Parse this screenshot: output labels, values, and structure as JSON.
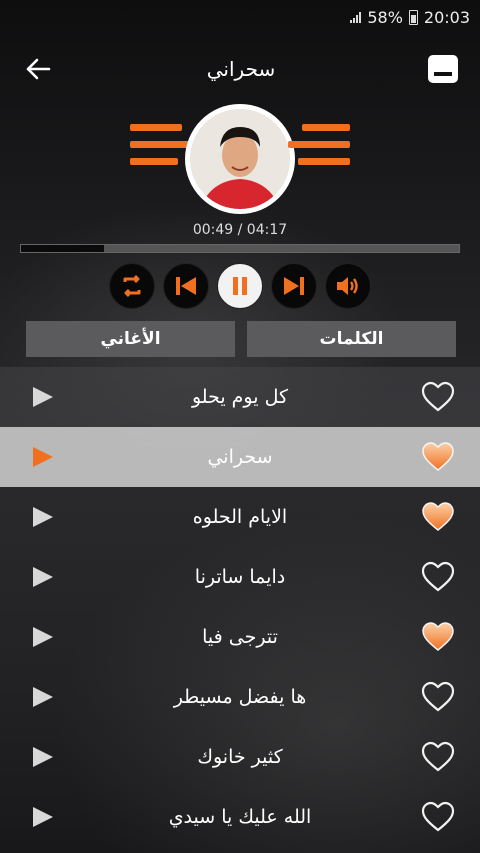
{
  "status_bar": {
    "battery_percent": "58%",
    "time": "20:03"
  },
  "header": {
    "title": "سحراني",
    "back_icon": "arrow-left-icon",
    "minimize_icon": "minimize-icon"
  },
  "player": {
    "time_display": "00:49 / 04:17",
    "progress": 0.19,
    "controls": [
      "repeat-icon",
      "skip-previous-icon",
      "pause-icon",
      "skip-next-icon",
      "volume-icon"
    ]
  },
  "tabs": {
    "songs": "الأغاني",
    "lyrics": "الكلمات"
  },
  "songs": [
    {
      "title": "كل يوم يحلو",
      "favorite": false,
      "active": false
    },
    {
      "title": "سحراني",
      "favorite": true,
      "active": true
    },
    {
      "title": "الايام الحلوه",
      "favorite": true,
      "active": false
    },
    {
      "title": "دايما ساترنا",
      "favorite": false,
      "active": false
    },
    {
      "title": "تترجى فيا",
      "favorite": true,
      "active": false
    },
    {
      "title": "ها يفضل مسيطر",
      "favorite": false,
      "active": false
    },
    {
      "title": "كثير خانوك",
      "favorite": false,
      "active": false
    },
    {
      "title": "الله عليك يا سيدي",
      "favorite": false,
      "active": false
    }
  ],
  "colors": {
    "accent": "#f07020",
    "active_row": "#d2d2d2"
  }
}
